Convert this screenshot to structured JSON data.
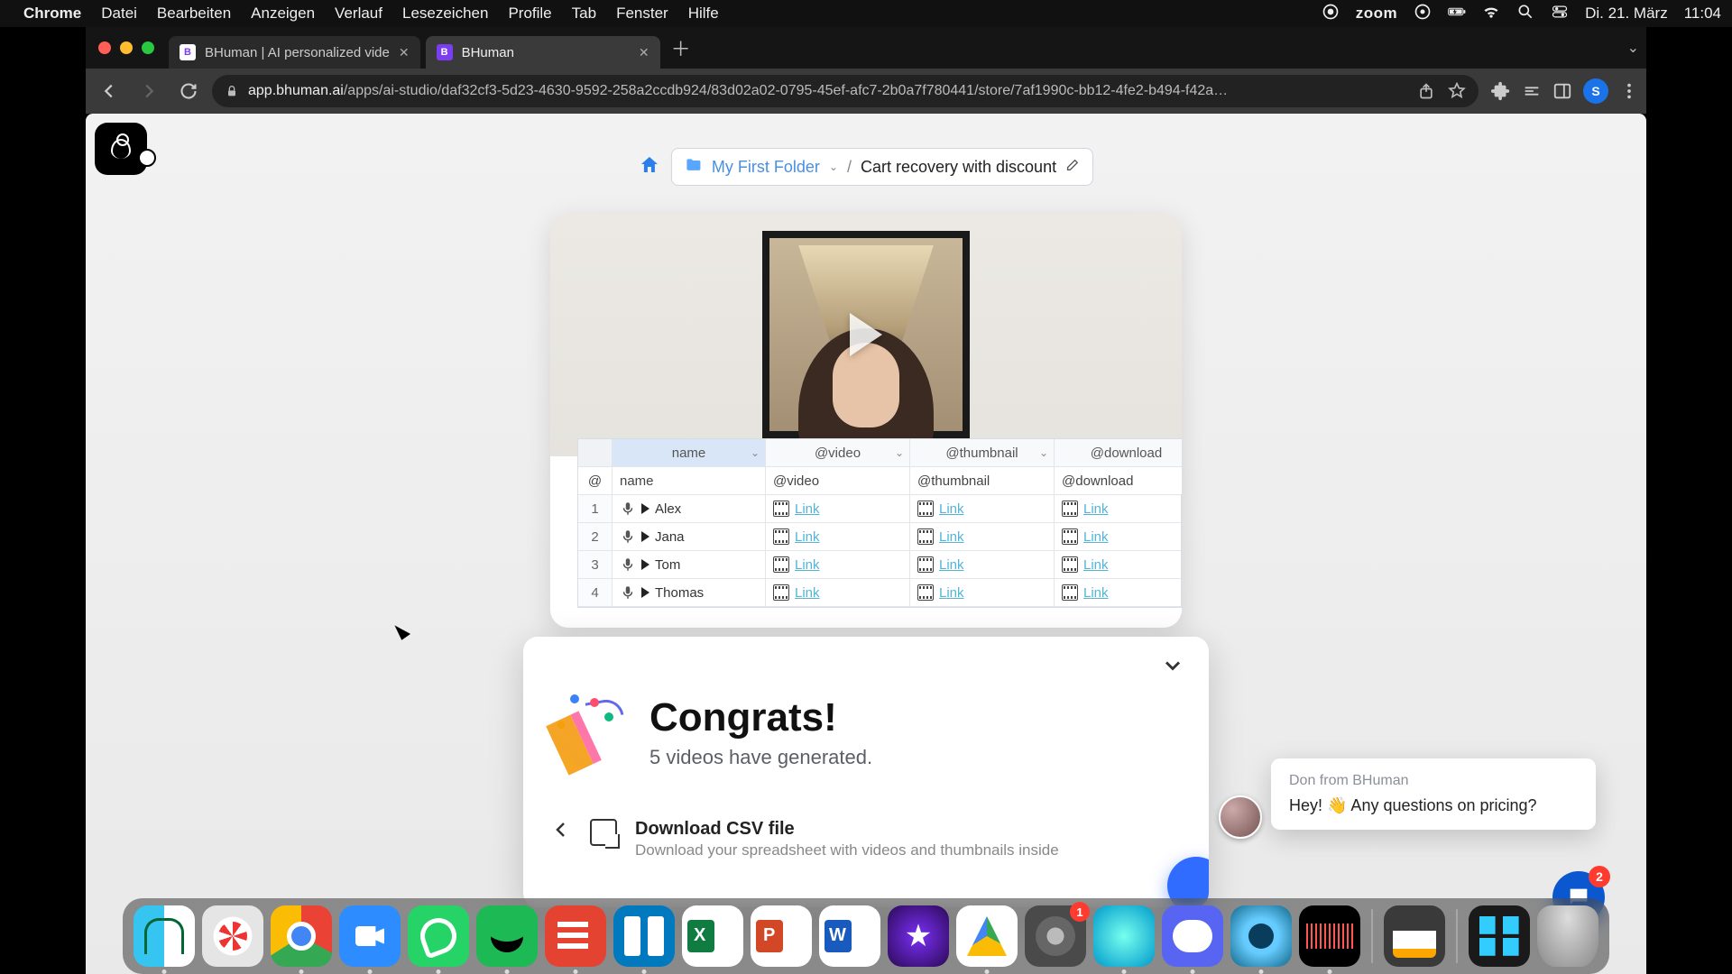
{
  "menubar": {
    "app": "Chrome",
    "items": [
      "Datei",
      "Bearbeiten",
      "Anzeigen",
      "Verlauf",
      "Lesezeichen",
      "Profile",
      "Tab",
      "Fenster",
      "Hilfe"
    ],
    "right": {
      "zoom": "zoom",
      "date": "Di. 21. März",
      "time": "11:04"
    }
  },
  "tabs": [
    {
      "title": "BHuman | AI personalized vide",
      "favicon_letter": "B",
      "favicon_bg": "#ffffff",
      "favicon_fg": "#7a3ef0",
      "active": false
    },
    {
      "title": "BHuman",
      "favicon_letter": "B",
      "favicon_bg": "#7a3ef0",
      "favicon_fg": "#ffffff",
      "active": true
    }
  ],
  "url": {
    "host": "app.bhuman.ai",
    "path": "/apps/ai-studio/daf32cf3-5d23-4630-9592-258a2ccdb924/83d02a02-0795-45ef-afc7-2b0a7f780441/store/7af1990c-bb12-4fe2-b494-f42a…"
  },
  "profile_initial": "S",
  "breadcrumb": {
    "folder": "My First Folder",
    "doc": "Cart recovery with discount"
  },
  "sheet": {
    "headers": [
      "name",
      "@video",
      "@thumbnail",
      "@download"
    ],
    "subheaders": [
      "@",
      "name",
      "@video",
      "@thumbnail",
      "@download"
    ],
    "link_label": "Link",
    "rows": [
      {
        "idx": "1",
        "name": "Alex"
      },
      {
        "idx": "2",
        "name": "Jana"
      },
      {
        "idx": "3",
        "name": "Tom"
      },
      {
        "idx": "4",
        "name": "Thomas"
      }
    ]
  },
  "congrats": {
    "title": "Congrats!",
    "subtitle": "5 videos have generated.",
    "download_title": "Download CSV file",
    "download_sub": "Download your spreadsheet with videos and thumbnails inside"
  },
  "chat": {
    "from": "Don from BHuman",
    "msg": "Hey! 👋 Any questions on pricing?",
    "badge": "2"
  },
  "dock_badge_settings": "1"
}
